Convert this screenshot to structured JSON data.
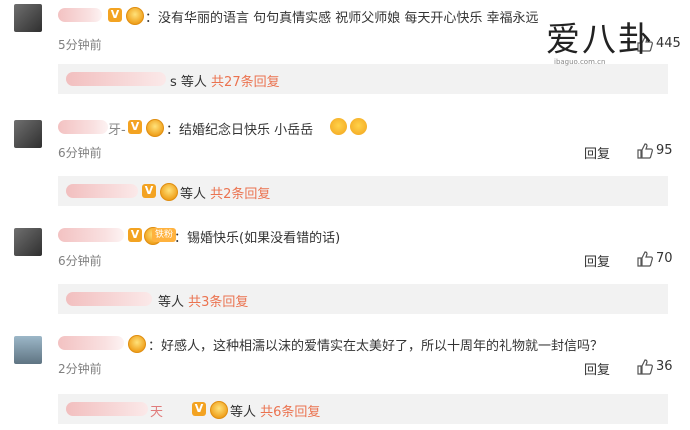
{
  "comments": [
    {
      "text": "：没有华丽的语言 句句真情实感 祝师父师娘 每天开心快乐 幸福永远",
      "time": "5分钟前",
      "like_count": "445",
      "sub": {
        "text_prefix": "s 等人 ",
        "count": "共27条回复"
      }
    },
    {
      "name_suffix": "牙-",
      "text": "：结婚纪念日快乐 小岳岳",
      "time": "6分钟前",
      "reply_label": "回复",
      "like_count": "95",
      "sub": {
        "text_prefix": "等人 ",
        "count": "共2条回复"
      }
    },
    {
      "badge_text": "铁粉",
      "text": "：锡婚快乐(如果没看错的话)",
      "time": "6分钟前",
      "reply_label": "回复",
      "like_count": "70",
      "sub": {
        "text_prefix": "等人 ",
        "count": "共3条回复"
      }
    },
    {
      "text": "：好感人，这种相濡以沫的爱情实在太美好了，所以十周年的礼物就一封信吗？",
      "time": "2分钟前",
      "reply_label": "回复",
      "like_count": "36",
      "sub": {
        "name_suffix": "天",
        "text_prefix": "等人 ",
        "count": "共6条回复"
      }
    }
  ],
  "watermark": {
    "chars": "爱八卦",
    "site": "ibaguo.com.cn"
  },
  "colors": {
    "accent": "#eb7350",
    "badge": "#f3a322",
    "sub_bg": "#f2f2f2"
  }
}
